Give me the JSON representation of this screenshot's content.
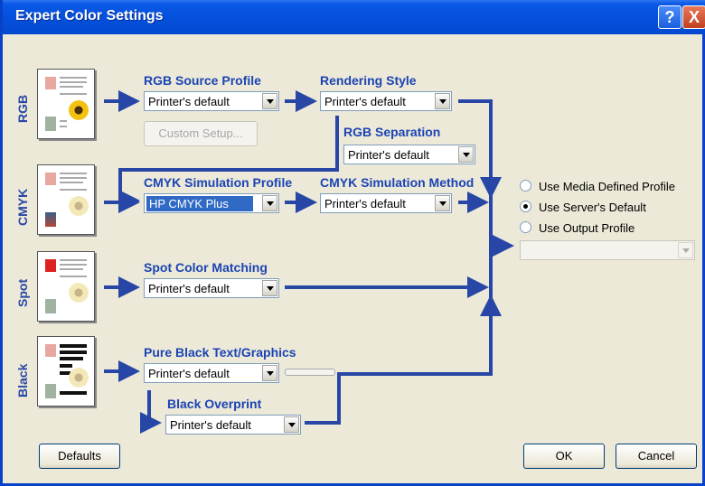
{
  "window": {
    "title": "Expert Color Settings",
    "help_symbol": "?",
    "close_symbol": "X"
  },
  "rows": {
    "rgb": "RGB",
    "cmyk": "CMYK",
    "spot": "Spot",
    "black": "Black"
  },
  "labels": {
    "rgb_source_profile": "RGB Source Profile",
    "rendering_style": "Rendering Style",
    "rgb_separation": "RGB Separation",
    "cmyk_simulation_profile": "CMYK Simulation Profile",
    "cmyk_simulation_method": "CMYK Simulation Method",
    "spot_color_matching": "Spot Color Matching",
    "pure_black": "Pure Black Text/Graphics",
    "black_overprint": "Black Overprint"
  },
  "selects": {
    "rgb_source_profile": "Printer's default",
    "rendering_style": "Printer's default",
    "rgb_separation": "Printer's default",
    "cmyk_simulation_profile": "HP CMYK Plus",
    "cmyk_simulation_method": "Printer's default",
    "spot_color_matching": "Printer's default",
    "pure_black": "Printer's default",
    "black_overprint": "Printer's default",
    "output_profile": ""
  },
  "output_options": {
    "use_media_defined": "Use Media Defined Profile",
    "use_server_default": "Use Server's Default",
    "use_output_profile": "Use Output Profile",
    "selected": "use_server_default"
  },
  "buttons": {
    "custom_setup": "Custom Setup...",
    "defaults": "Defaults",
    "ok": "OK",
    "cancel": "Cancel"
  },
  "colors": {
    "accent": "#1c44b4",
    "flow": "#2746a6",
    "highlight": "#316ac5"
  }
}
